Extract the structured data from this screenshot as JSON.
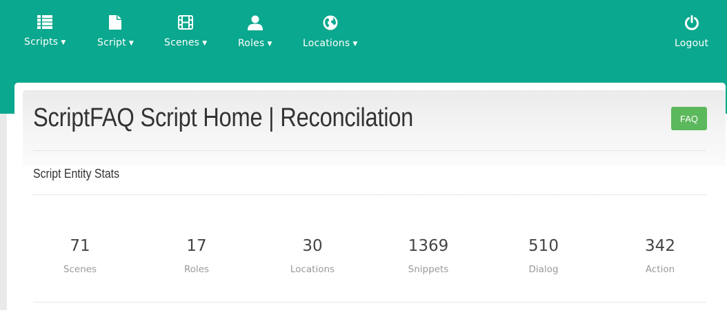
{
  "nav": {
    "items": [
      {
        "label": "Scripts",
        "icon": "list-icon"
      },
      {
        "label": "Script",
        "icon": "file-icon"
      },
      {
        "label": "Scenes",
        "icon": "film-icon"
      },
      {
        "label": "Roles",
        "icon": "user-icon"
      },
      {
        "label": "Locations",
        "icon": "globe-icon"
      }
    ],
    "logout": {
      "label": "Logout",
      "icon": "power-icon"
    }
  },
  "header": {
    "title": "ScriptFAQ Script Home | Reconcilation",
    "faq_label": "FAQ"
  },
  "section": {
    "heading": "Script Entity Stats"
  },
  "stats": [
    {
      "value": "71",
      "label": "Scenes"
    },
    {
      "value": "17",
      "label": "Roles"
    },
    {
      "value": "30",
      "label": "Locations"
    },
    {
      "value": "1369",
      "label": "Snippets"
    },
    {
      "value": "510",
      "label": "Dialog"
    },
    {
      "value": "342",
      "label": "Action"
    }
  ],
  "colors": {
    "navbar": "#0aa88e",
    "faq_button": "#5cb85c"
  }
}
